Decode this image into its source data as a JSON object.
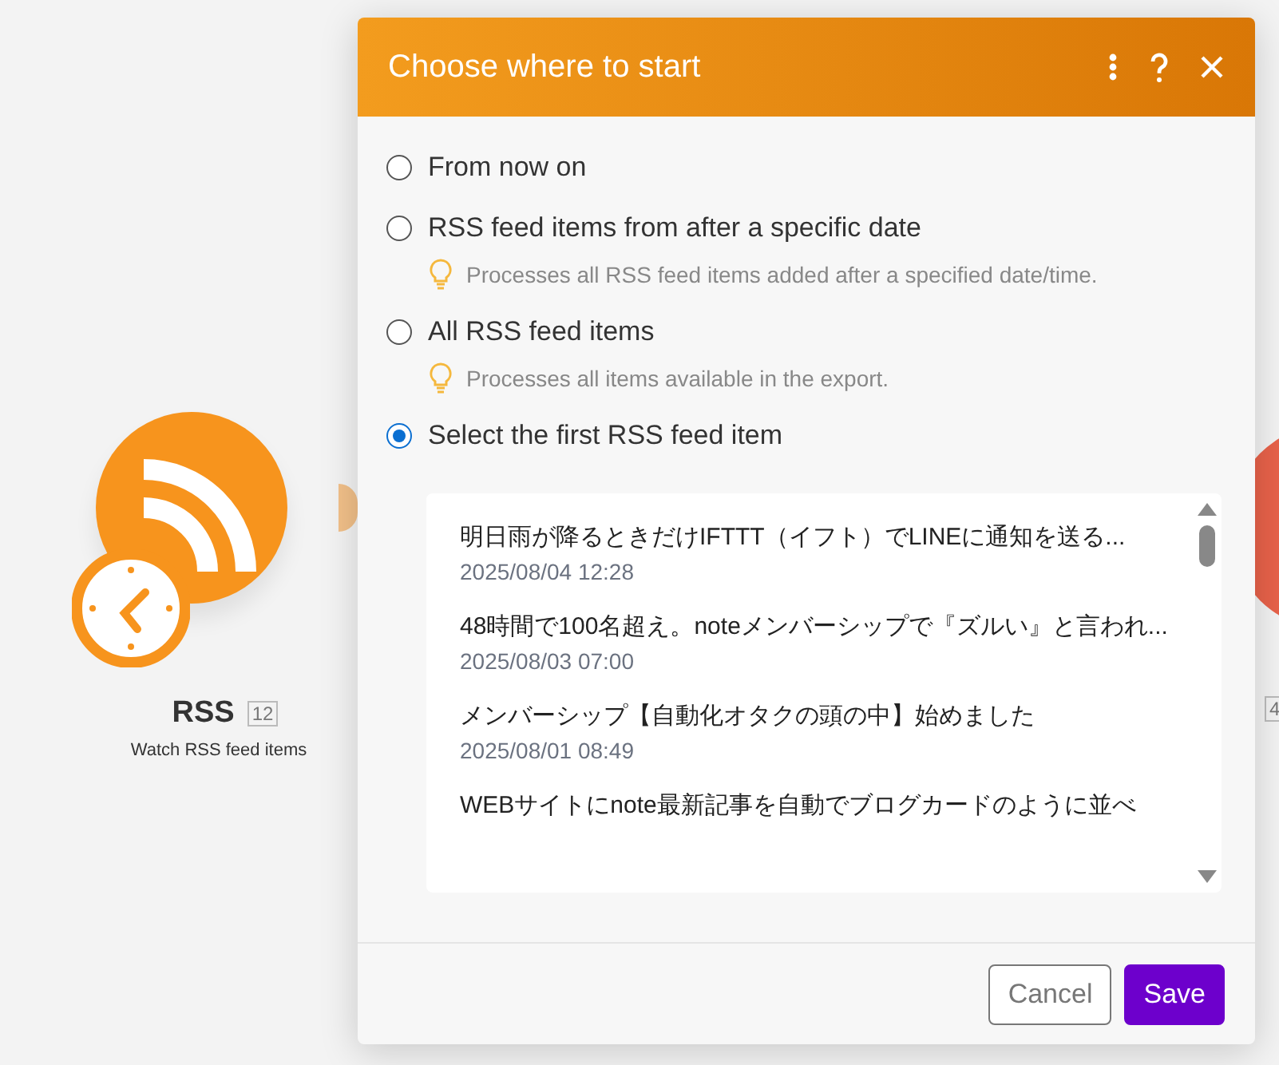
{
  "canvas": {
    "nodes": [
      {
        "title": "RSS",
        "count": "12",
        "subtitle": "Watch RSS feed items"
      }
    ],
    "partial_count": "4"
  },
  "dialog": {
    "title": "Choose where to start",
    "options": [
      {
        "label": "From now on",
        "selected": false
      },
      {
        "label": "RSS feed items from after a specific date",
        "hint": "Processes all RSS feed items added after a specified date/time.",
        "selected": false
      },
      {
        "label": "All RSS feed items",
        "hint": "Processes all items available in the export.",
        "selected": false
      },
      {
        "label": "Select the first RSS feed item",
        "selected": true
      }
    ],
    "items": [
      {
        "title": "明日雨が降るときだけIFTTT（イフト）でLINEに通知を送る...",
        "date": "2025/08/04 12:28"
      },
      {
        "title": "48時間で100名超え。noteメンバーシップで『ズルい』と言われ...",
        "date": "2025/08/03 07:00"
      },
      {
        "title": "メンバーシップ【自動化オタクの頭の中】始めました",
        "date": "2025/08/01 08:49"
      },
      {
        "title": "WEBサイトにnote最新記事を自動でブログカードのように並べ"
      }
    ],
    "buttons": [
      {
        "label": "Cancel",
        "kind": "secondary"
      },
      {
        "label": "Save",
        "kind": "primary"
      }
    ]
  }
}
